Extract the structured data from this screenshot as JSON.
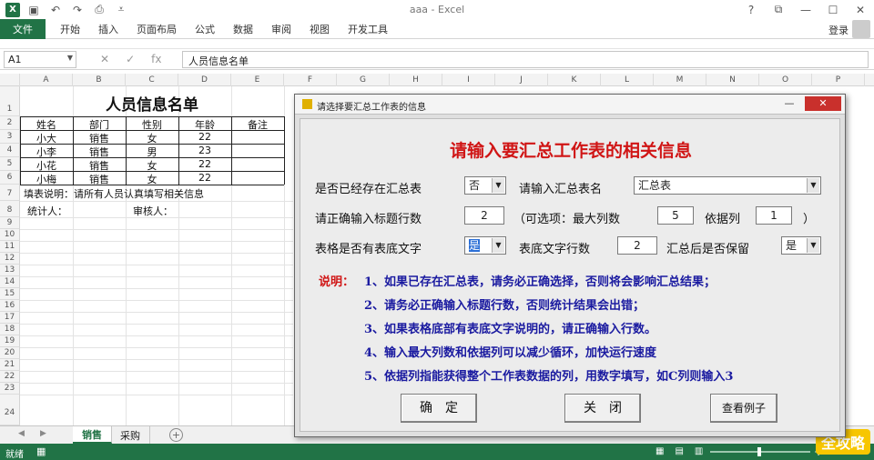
{
  "window": {
    "title": "aaa - Excel",
    "controls": [
      "?",
      "⧉",
      "—",
      "☐",
      "✕"
    ]
  },
  "ribbon": {
    "file": "文件",
    "tabs": [
      "开始",
      "插入",
      "页面布局",
      "公式",
      "数据",
      "审阅",
      "视图",
      "开发工具"
    ],
    "login": "登录"
  },
  "formula_bar": {
    "name_box": "A1",
    "formula": "人员信息名单",
    "fx": "fx"
  },
  "columns": [
    "A",
    "B",
    "C",
    "D",
    "E",
    "F",
    "G",
    "H",
    "I",
    "J",
    "K",
    "L",
    "M",
    "N",
    "O",
    "P"
  ],
  "rows": [
    "1",
    "2",
    "3",
    "4",
    "5",
    "6",
    "7",
    "8",
    "9",
    "10",
    "11",
    "12",
    "13",
    "14",
    "15",
    "16",
    "17",
    "18",
    "19",
    "20",
    "21",
    "22",
    "23",
    "24"
  ],
  "sheet": {
    "title": "人员信息名单",
    "headers": [
      "姓名",
      "部门",
      "性别",
      "年龄",
      "备注"
    ],
    "records": [
      [
        "小大",
        "销售",
        "女",
        "22",
        ""
      ],
      [
        "小李",
        "销售",
        "男",
        "23",
        ""
      ],
      [
        "小花",
        "销售",
        "女",
        "22",
        ""
      ],
      [
        "小梅",
        "销售",
        "女",
        "22",
        ""
      ]
    ],
    "note": "填表说明：请所有人员认真填写相关信息",
    "stat_label": "统计人：",
    "review_label": "审核人："
  },
  "sheet_tabs": [
    "销售",
    "采购"
  ],
  "status": {
    "ready": "就绪",
    "zoom": "+"
  },
  "watermark": "全攻略",
  "dialog": {
    "title": "请选择要汇总工作表的信息",
    "min": "—",
    "close": "✕",
    "heading": "请输入要汇总工作表的相关信息",
    "exists_label": "是否已经存在汇总表",
    "exists_value": "否",
    "name_label": "请输入汇总表名",
    "name_value": "汇总表",
    "header_rows_label": "请正确输入标题行数",
    "header_rows_value": "2",
    "optional_label": "（可选项：最大列数",
    "max_cols_value": "5",
    "by_col_label": "依据列",
    "by_col_value": "1",
    "close_paren": "）",
    "footer_label": "表格是否有表底文字",
    "footer_value": "是",
    "footer_rows_label": "表底文字行数",
    "footer_rows_value": "2",
    "keep_label": "汇总后是否保留",
    "keep_value": "是",
    "notes_title": "说明：",
    "notes": [
      "1、如果已存在汇总表，请务必正确选择，否则将会影响汇总结果；",
      "2、请务必正确输入标题行数，否则统计结果会出错；",
      "3、如果表格底部有表底文字说明的，请正确输入行数。",
      "4、输入最大列数和依据列可以减少循环，加快运行速度",
      "5、依据列指能获得整个工作表数据的列，用数字填写，如C列则输入3"
    ],
    "ok_button": "确　定",
    "close_button": "关　闭",
    "example_button": "查看例子"
  }
}
